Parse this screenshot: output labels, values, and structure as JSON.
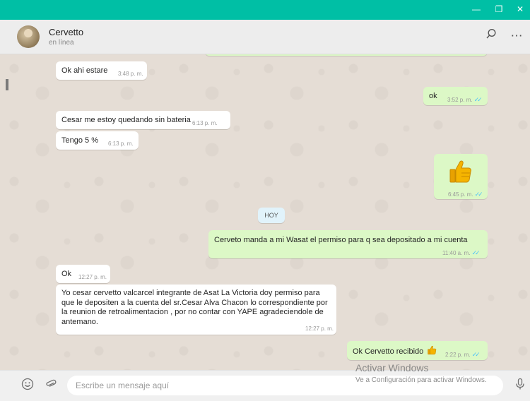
{
  "window": {
    "controls": {
      "minimize": "—",
      "restore": "❐",
      "close": "✕"
    }
  },
  "chat_header": {
    "contact_name": "Cervetto",
    "status": "en línea",
    "search_icon": "search-icon",
    "menu_icon": "more-icon",
    "menu_glyph": "⋯"
  },
  "messages": [
    {
      "dir": "in",
      "text": "Ok ahi estare",
      "time": "3:48 p. m."
    },
    {
      "dir": "out",
      "text": "ok",
      "time": "3:52 p. m.",
      "ticks": "✓✓"
    },
    {
      "dir": "in",
      "text": "Cesar me estoy quedando sin bateria",
      "time": "6:13 p. m."
    },
    {
      "dir": "in",
      "text": "Tengo 5 %",
      "time": "6:13 p. m."
    },
    {
      "dir": "out",
      "emoji": "thumbs-up",
      "time": "6:45 p. m.",
      "ticks": "✓✓"
    },
    {
      "dir": "out",
      "text": "Cerveto manda a mi Wasat el permiso para q sea depositado a mi cuenta",
      "time": "11:40 a. m.",
      "ticks": "✓✓"
    },
    {
      "dir": "in",
      "text": "Ok",
      "time": "12:27 p. m."
    },
    {
      "dir": "in",
      "lines": [
        "Yo cesar cervetto valcarcel integrante de Asat La Victoria doy permiso para",
        "que le depositen a la cuenta del sr.Cesar Alva Chacon lo correspondiente por",
        "la reunion de retroalimentacion , por no contar con YAPE agradeciendole de",
        "antemano."
      ],
      "time": "12:27 p. m."
    },
    {
      "dir": "out",
      "text": "Ok Cervetto recibido",
      "time": "2:22 p. m.",
      "ticks": "✓✓",
      "emoji": "thumbs-up"
    }
  ],
  "day_separator": "HOY",
  "composer": {
    "placeholder": "Escribe un mensaje aquí",
    "emoji_icon": "emoji-icon",
    "attach_icon": "paperclip-icon",
    "mic_icon": "microphone-icon"
  },
  "watermark": {
    "title": "Activar Windows",
    "subtitle": "Ve a Configuración para activar Windows."
  },
  "colors": {
    "titlebar": "#00bfa5",
    "incoming": "#ffffff",
    "outgoing": "#dcf8c6",
    "read_ticks": "#4fc3f7",
    "chat_bg": "#e5ddd5"
  }
}
